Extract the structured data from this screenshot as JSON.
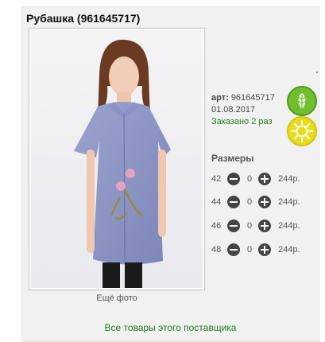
{
  "product": {
    "title": "Рубашка (961645717)",
    "more_photo": "Ещё фото",
    "article_label": "арт:",
    "article_value": "961645717",
    "date": "01.08.2017",
    "ordered": "Заказано 2 раз",
    "eco_badge_icon": "leaf-icon",
    "sun_badge_icon": "sun-icon"
  },
  "sizes": {
    "heading": "Размеры",
    "rows": [
      {
        "size": "42",
        "qty": "0",
        "price": "244р."
      },
      {
        "size": "44",
        "qty": "0",
        "price": "244р."
      },
      {
        "size": "46",
        "qty": "0",
        "price": "244р."
      },
      {
        "size": "48",
        "qty": "0",
        "price": "244р."
      }
    ]
  },
  "footer": {
    "supplier_link": "Все товары этого поставщика"
  },
  "colors": {
    "accent_green": "#1f7d1f",
    "leaf_badge": "#6fbf2e",
    "sun_badge": "#e8dc1a"
  }
}
